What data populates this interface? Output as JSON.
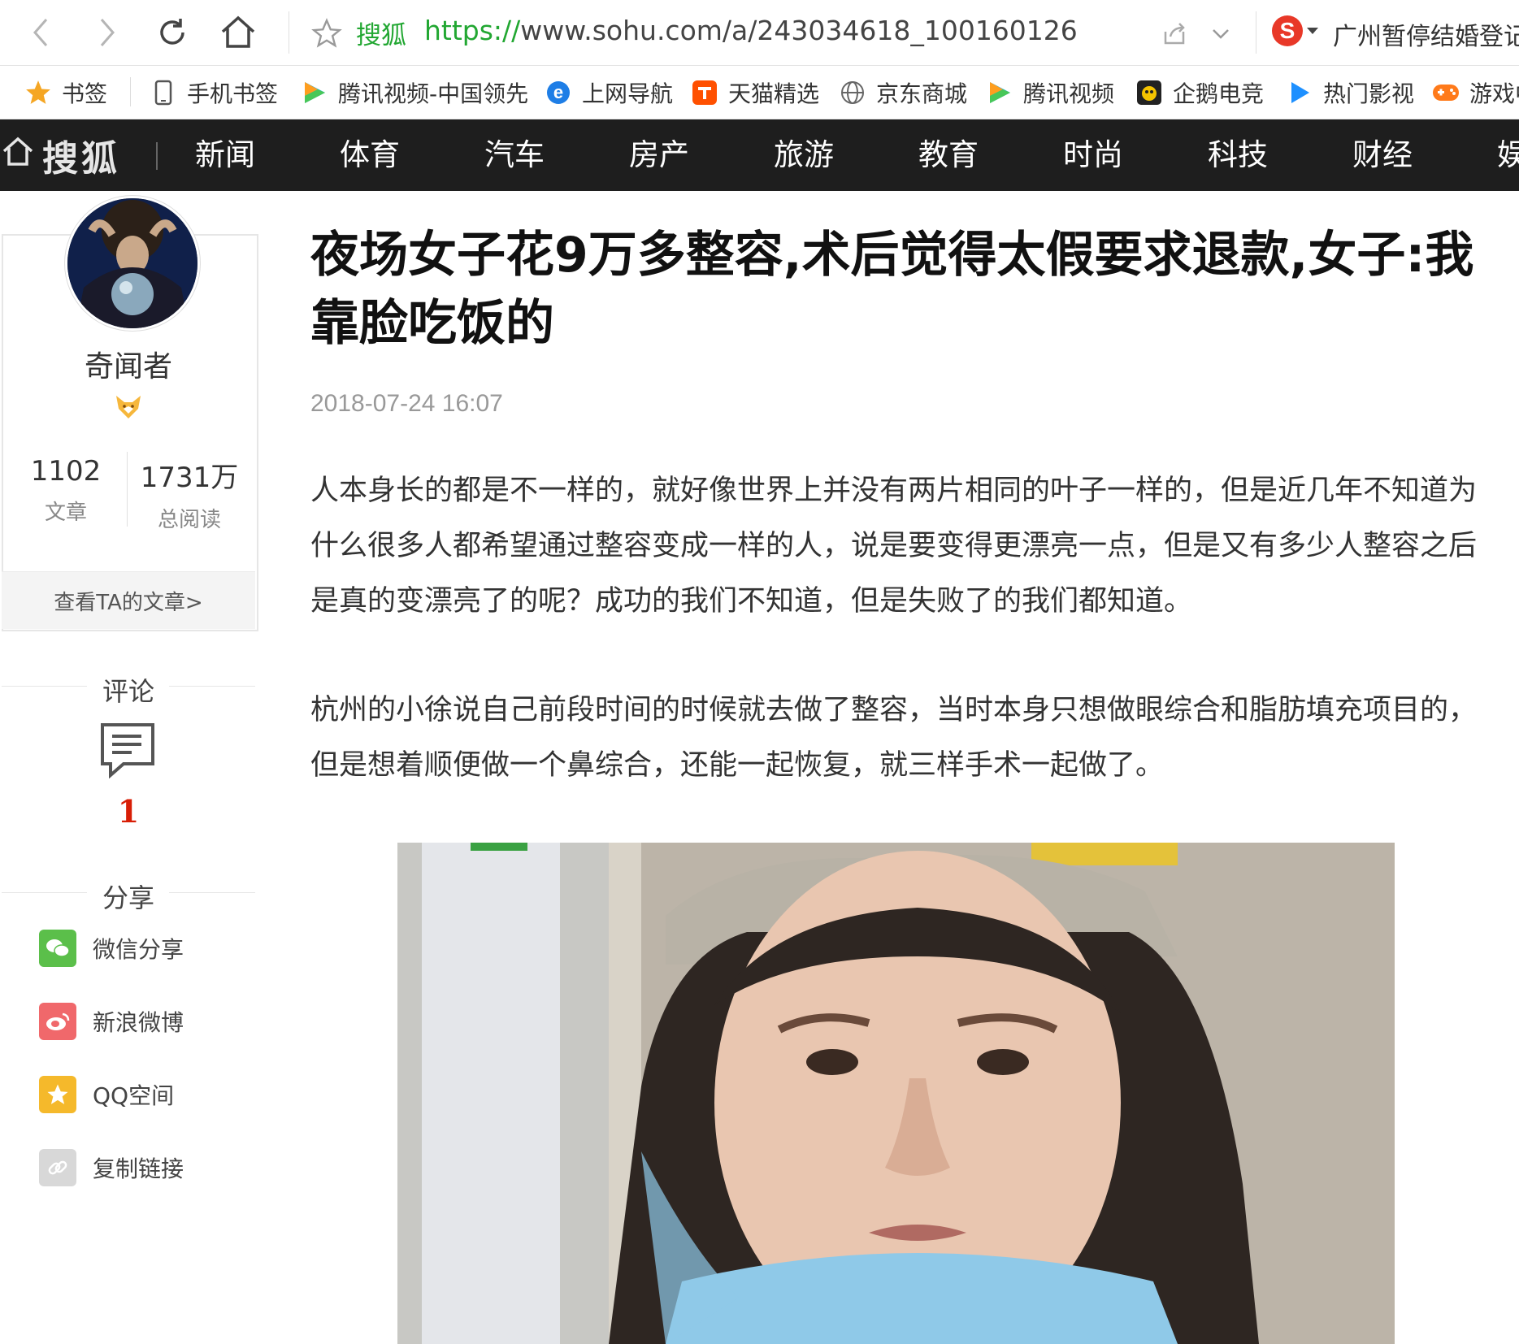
{
  "browser": {
    "address_site": "搜狐",
    "url_protocol": "https://",
    "url_rest": "www.sohu.com/a/243034618_100160126",
    "hot_search": "广州暂停结婚登记"
  },
  "bookmarks": [
    {
      "label": "书签",
      "icon": "star-icon"
    },
    {
      "label": "手机书签",
      "icon": "phone-icon"
    },
    {
      "label": "腾讯视频-中国领先",
      "icon": "tencent-video-icon"
    },
    {
      "label": "上网导航",
      "icon": "ie-icon"
    },
    {
      "label": "天猫精选",
      "icon": "tmall-icon"
    },
    {
      "label": "京东商城",
      "icon": "globe-icon"
    },
    {
      "label": "腾讯视频",
      "icon": "tencent-video-icon"
    },
    {
      "label": "企鹅电竞",
      "icon": "penguin-esports-icon"
    },
    {
      "label": "热门影视",
      "icon": "play-icon"
    },
    {
      "label": "游戏中",
      "icon": "gamepad-icon"
    }
  ],
  "sohu_nav": {
    "logo": "搜狐",
    "items": [
      "新闻",
      "体育",
      "汽车",
      "房产",
      "旅游",
      "教育",
      "时尚",
      "科技",
      "财经",
      "娱乐"
    ]
  },
  "author": {
    "name": "奇闻者",
    "articles_count": "1102",
    "articles_label": "文章",
    "reads_count": "1731万",
    "reads_label": "总阅读",
    "view_articles": "查看TA的文章>"
  },
  "comments": {
    "title": "评论",
    "count": "1"
  },
  "share": {
    "title": "分享",
    "items": [
      {
        "label": "微信分享",
        "icon": "wechat-icon",
        "color": "#5bbf4a"
      },
      {
        "label": "新浪微博",
        "icon": "weibo-icon",
        "color": "#f0686b"
      },
      {
        "label": "QQ空间",
        "icon": "qzone-icon",
        "color": "#f5b92b"
      },
      {
        "label": "复制链接",
        "icon": "link-icon",
        "color": "#cfcfcf"
      }
    ]
  },
  "article": {
    "title": "夜场女子花9万多整容,术后觉得太假要求退款,女子:我靠脸吃饭的",
    "time": "2018-07-24 16:07",
    "paragraphs": [
      "人本身长的都是不一样的，就好像世界上并没有两片相同的叶子一样的，但是近几年不知道为什么很多人都希望通过整容变成一样的人，说是要变得更漂亮一点，但是又有多少人整容之后是真的变漂亮了的呢？成功的我们不知道，但是失败了的我们都知道。",
      "杭州的小徐说自己前段时间的时候就去做了整容，当时本身只想做眼综合和脂肪填充项目的，但是想着顺便做一个鼻综合，还能一起恢复，就三样手术一起做了。"
    ]
  },
  "colors": {
    "nav_bg": "#1e1e1e",
    "accent_green": "#22a732",
    "comment_red": "#d81e06"
  }
}
